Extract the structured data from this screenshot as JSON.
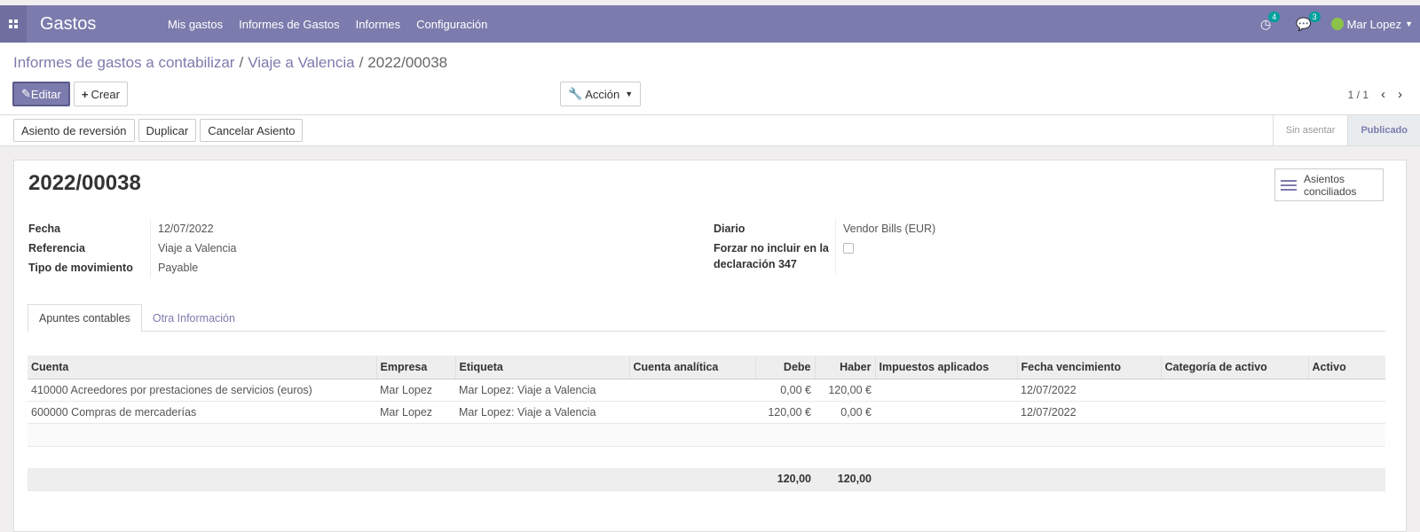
{
  "app": {
    "title": "Gastos"
  },
  "nav": [
    "Mis gastos",
    "Informes de Gastos",
    "Informes",
    "Configuración"
  ],
  "topbar": {
    "activity_count": "4",
    "messages_count": "3",
    "user": "Mar Lopez"
  },
  "breadcrumb": {
    "part1": "Informes de gastos a contabilizar",
    "part2": "Viaje a Valencia",
    "current": "2022/00038"
  },
  "toolbar": {
    "edit": "Editar",
    "create": "Crear",
    "action": "Acción",
    "pager": "1 / 1"
  },
  "status_buttons": [
    "Asiento de reversión",
    "Duplicar",
    "Cancelar Asiento"
  ],
  "stages": [
    "Sin asentar",
    "Publicado"
  ],
  "record": {
    "title": "2022/00038",
    "smart_button": "Asientos conciliados",
    "fecha_label": "Fecha",
    "fecha": "12/07/2022",
    "referencia_label": "Referencia",
    "referencia": "Viaje a Valencia",
    "tipo_label": "Tipo de movimiento",
    "tipo": "Payable",
    "diario_label": "Diario",
    "diario": "Vendor Bills (EUR)",
    "forzar_label": "Forzar no incluir en la declaración 347"
  },
  "tabs": [
    "Apuntes contables",
    "Otra Información"
  ],
  "table": {
    "headers": [
      "Cuenta",
      "Empresa",
      "Etiqueta",
      "Cuenta analítica",
      "Debe",
      "Haber",
      "Impuestos aplicados",
      "Fecha vencimiento",
      "Categoría de activo",
      "Activo"
    ],
    "rows": [
      [
        "410000 Acreedores por prestaciones de servicios (euros)",
        "Mar Lopez",
        "Mar Lopez: Viaje a Valencia",
        "",
        "0,00 €",
        "120,00 €",
        "",
        "12/07/2022",
        "",
        ""
      ],
      [
        "600000 Compras de mercaderías",
        "Mar Lopez",
        "Mar Lopez: Viaje a Valencia",
        "",
        "120,00 €",
        "0,00 €",
        "",
        "12/07/2022",
        "",
        ""
      ]
    ],
    "total_debe": "120,00",
    "total_haber": "120,00"
  }
}
